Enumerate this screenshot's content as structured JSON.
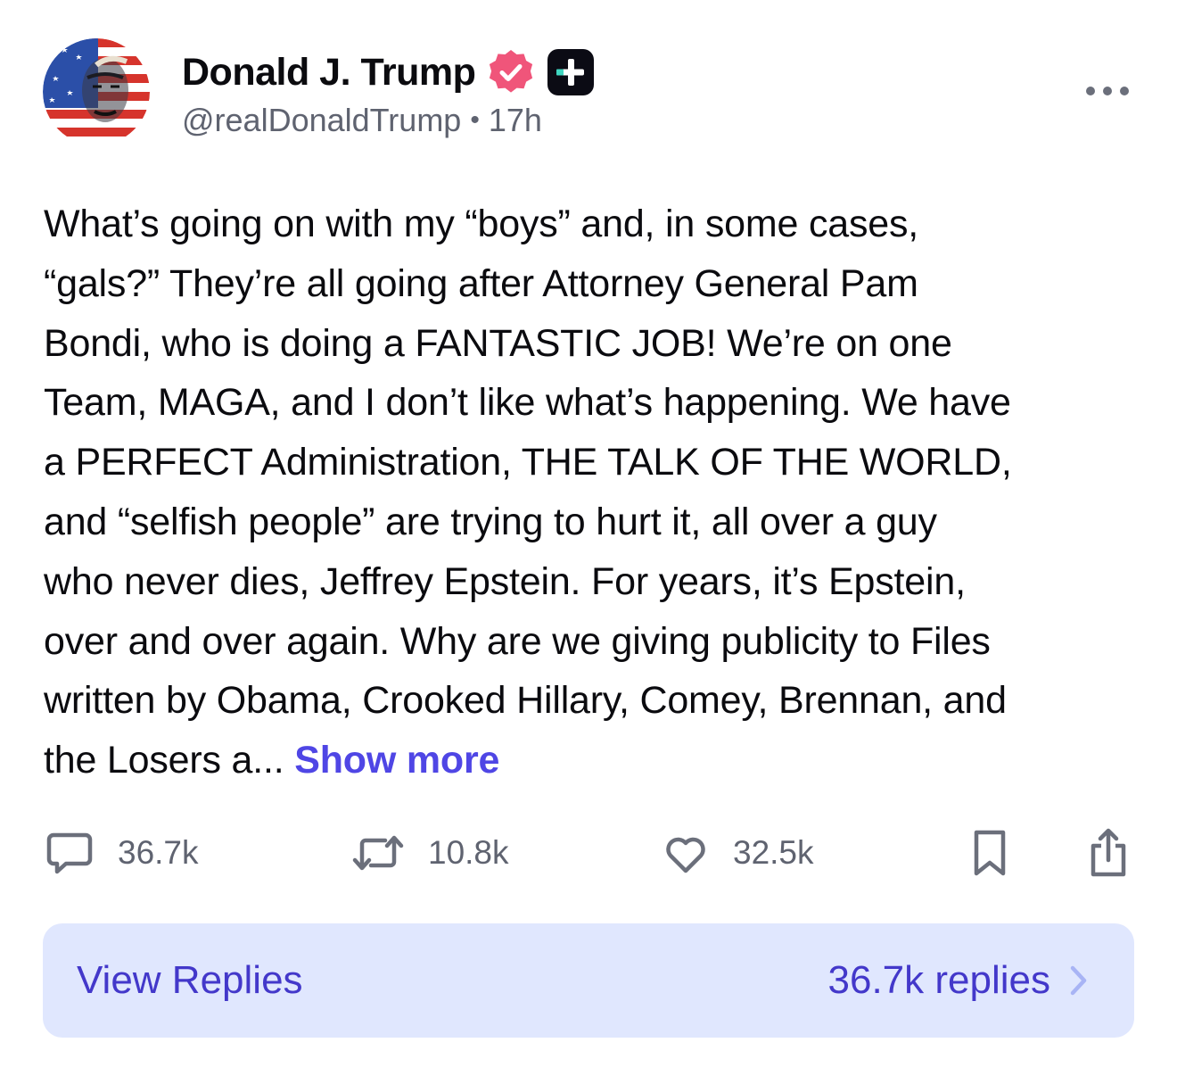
{
  "author": {
    "name": "Donald J. Trump",
    "handle": "@realDonaldTrump",
    "time": "17h",
    "separator": "•"
  },
  "post": {
    "lines": [
      "What’s going on with my “boys” and, in some cases,",
      "“gals?” They’re all going after Attorney General Pam",
      "Bondi, who is doing a FANTASTIC JOB! We’re on one",
      "Team, MAGA, and I don’t like what’s happening. We have",
      "a PERFECT Administration, THE TALK OF THE WORLD,",
      "and “selfish people” are trying to hurt it, all over a guy",
      "who never dies, Jeffrey Epstein. For years, it’s Epstein,",
      "over and over again. Why are we giving publicity to Files",
      "written by Obama, Crooked Hillary, Comey, Brennan, and"
    ],
    "last_line": "the Losers a...",
    "show_more": "Show more"
  },
  "actions": {
    "replies": "36.7k",
    "restruths": "10.8k",
    "likes": "32.5k"
  },
  "view_replies": {
    "label": "View Replies",
    "count": "36.7k replies"
  },
  "colors": {
    "accent": "#4f46e5",
    "verified": "#f0557a",
    "replies_bg": "#e0e7fe",
    "muted": "#5f6370"
  },
  "icons": {
    "verified": "verified-badge-icon",
    "plus": "plus-badge-icon",
    "more": "more-dots-icon",
    "reply": "comment-icon",
    "restruth": "repost-icon",
    "like": "heart-icon",
    "bookmark": "bookmark-icon",
    "share": "share-icon",
    "chevron": "chevron-right-icon"
  }
}
